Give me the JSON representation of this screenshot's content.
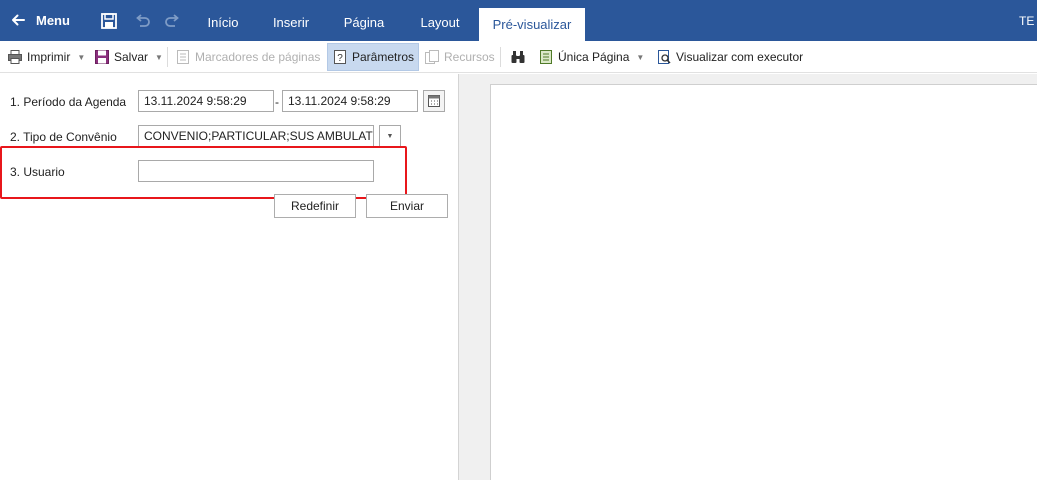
{
  "ribbon": {
    "menu_label": "Menu",
    "tabs": [
      {
        "label": "Início"
      },
      {
        "label": "Inserir"
      },
      {
        "label": "Página"
      },
      {
        "label": "Layout"
      },
      {
        "label": "Pré-visualizar"
      }
    ],
    "active_tab": "Pré-visualizar",
    "truncated_right_label": "TE"
  },
  "toolbar": {
    "print_label": "Imprimir",
    "save_label": "Salvar",
    "bookmarks_label": "Marcadores de páginas",
    "parameters_label": "Parâmetros",
    "resources_label": "Recursos",
    "single_page_label": "Única Página",
    "view_executor_label": "Visualizar com executor"
  },
  "parameters": {
    "period": {
      "label": "1. Período da Agenda",
      "from": "13.11.2024 9:58:29",
      "separator": "-",
      "to": "13.11.2024 9:58:29"
    },
    "agreement": {
      "label": "2. Tipo de Convênio",
      "value": "CONVENIO;PARTICULAR;SUS AMBULATORIAL"
    },
    "user": {
      "label": "3. Usuario",
      "value": ""
    },
    "reset_label": "Redefinir",
    "submit_label": "Enviar"
  },
  "colors": {
    "ribbon": "#2b579a",
    "highlight": "#e8161b",
    "selected_tool": "#c8d9ef"
  }
}
